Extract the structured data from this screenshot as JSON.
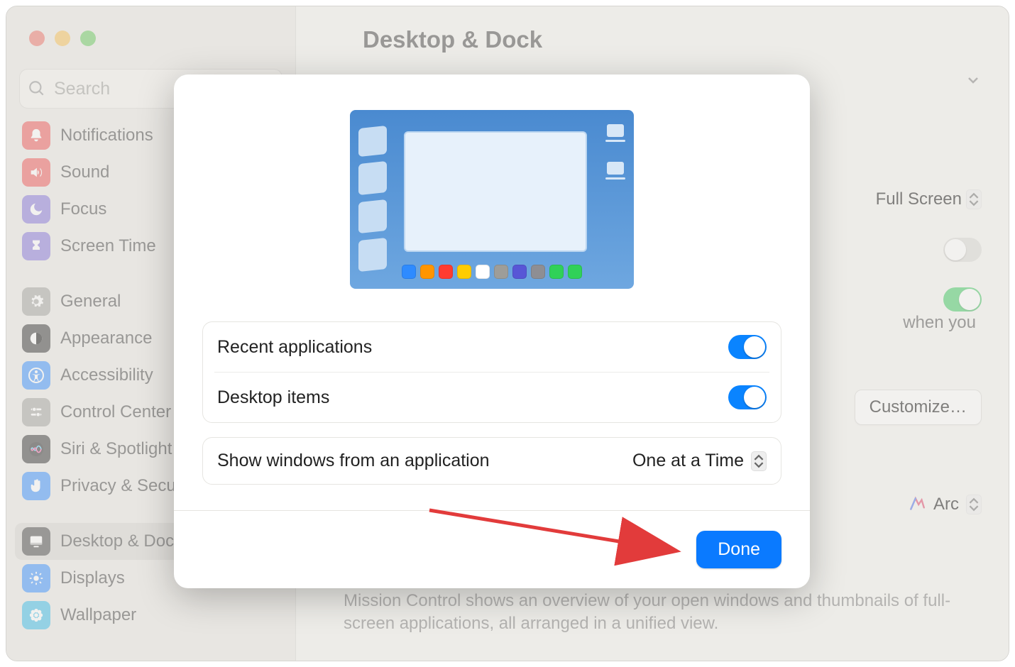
{
  "window": {
    "title": "Desktop & Dock",
    "search_placeholder": "Search",
    "sidebar": {
      "items": [
        {
          "id": "notifications",
          "label": "Notifications",
          "color": "#ee4e4e",
          "svg": "bell"
        },
        {
          "id": "sound",
          "label": "Sound",
          "color": "#ee4e4e",
          "svg": "speaker"
        },
        {
          "id": "focus",
          "label": "Focus",
          "color": "#7e6ed7",
          "svg": "moon"
        },
        {
          "id": "screentime",
          "label": "Screen Time",
          "color": "#7e6ed7",
          "svg": "hourglass"
        },
        {
          "gap": true
        },
        {
          "id": "general",
          "label": "General",
          "color": "#9e9d99",
          "svg": "gear"
        },
        {
          "id": "appearance",
          "label": "Appearance",
          "color": "#2b2b2b",
          "svg": "appearance"
        },
        {
          "id": "accessibility",
          "label": "Accessibility",
          "color": "#2e8bff",
          "svg": "accessibility"
        },
        {
          "id": "controlcenter",
          "label": "Control Center",
          "color": "#9e9d99",
          "svg": "sliders"
        },
        {
          "id": "siri",
          "label": "Siri & Spotlight",
          "color": "#2b2b2b",
          "svg": "siri"
        },
        {
          "id": "privacy",
          "label": "Privacy & Security",
          "color": "#2e8bff",
          "svg": "hand"
        },
        {
          "gap": true
        },
        {
          "id": "desktopdock",
          "label": "Desktop & Dock",
          "color": "#3b3b3b",
          "svg": "desktop",
          "selected": true
        },
        {
          "id": "displays",
          "label": "Displays",
          "color": "#2e8bff",
          "svg": "sun"
        },
        {
          "id": "wallpaper",
          "label": "Wallpaper",
          "color": "#2fb9e6",
          "svg": "flower"
        }
      ]
    },
    "bg": {
      "fullscreen_label": "Full Screen",
      "when_you": "when you",
      "customize_label": "Customize…",
      "arc_label": "Arc",
      "mc_text": "Mission Control shows an overview of your open windows and thumbnails of full-screen applications, all arranged in a unified view."
    }
  },
  "modal": {
    "dock_colors": [
      "#2e8bff",
      "#ff9500",
      "#ff3b30",
      "#ffcc00",
      "#ffffff",
      "#9e9d99",
      "#5856d6",
      "#8e8e93",
      "#30d158",
      "#30d158"
    ],
    "rows": {
      "recent_apps": {
        "label": "Recent applications",
        "on": true
      },
      "desktop_items": {
        "label": "Desktop items",
        "on": true
      }
    },
    "show_windows": {
      "label": "Show windows from an application",
      "value": "One at a Time"
    },
    "done_label": "Done"
  }
}
